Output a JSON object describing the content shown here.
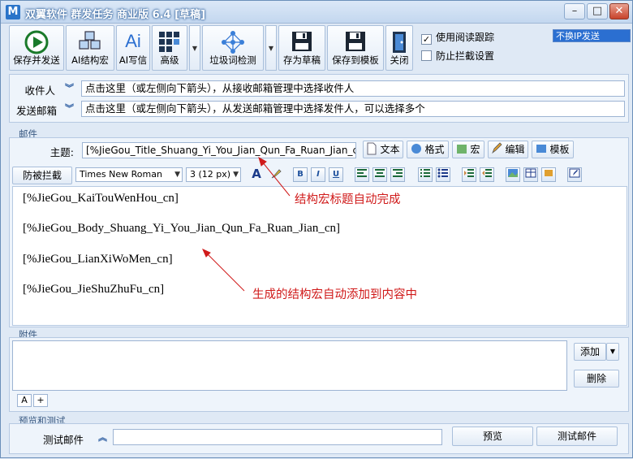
{
  "window": {
    "title": "双翼软件 群发任务 商业版 6.4 [草稿]",
    "app_icon_letter": "M",
    "min_glyph": "–",
    "max_glyph": "□",
    "close_glyph": "✕"
  },
  "toolbar": {
    "save_send": "保存并发送",
    "ai_macro": "AI结构宏",
    "ai_write": "AI写信",
    "advanced": "高级",
    "spam_check": "垃圾词检测",
    "save_draft": "存为草稿",
    "save_template": "保存到模板",
    "close": "关闭",
    "ai_icon_text": "Ai"
  },
  "options": {
    "read_tracking_label": "使用阅读跟踪",
    "read_tracking_checked": true,
    "anti_block_label": "防止拦截设置",
    "anti_block_checked": false,
    "ip_mode": "不换IP发送"
  },
  "recipients": {
    "to_label": "收件人",
    "to_value": "点击这里（或左侧向下箭头），从接收邮箱管理中选择收件人",
    "from_label": "发送邮箱",
    "from_value": "点击这里（或左侧向下箭头），从发送邮箱管理中选择发件人，可以选择多个"
  },
  "mail": {
    "group_label": "邮件",
    "subject_label": "主题:",
    "subject_value": "[%JieGou_Title_Shuang_Yi_You_Jian_Qun_Fa_Ruan_Jian_cn]",
    "btn_text": "文本",
    "btn_format": "格式",
    "btn_macro": "宏",
    "btn_edit": "编辑",
    "btn_template": "模板"
  },
  "format_bar": {
    "anti_block": "防被拦截",
    "font": "Times New Roman",
    "size": "3 (12 px)",
    "bold": "B",
    "italic": "I",
    "underline": "U",
    "font_color_glyph": "A"
  },
  "body": {
    "lines": [
      "[%JieGou_KaiTouWenHou_cn]",
      "[%JieGou_Body_Shuang_Yi_You_Jian_Qun_Fa_Ruan_Jian_cn]",
      "[%JieGou_LianXiWoMen_cn]",
      "[%JieGou_JieShuZhuFu_cn]"
    ],
    "annotation_title": "结构宏标题自动完成",
    "annotation_body": "生成的结构宏自动添加到内容中"
  },
  "attachments": {
    "group_label": "附件",
    "add": "添加",
    "delete": "删除",
    "tab_a": "A",
    "tab_plus": "+"
  },
  "preview": {
    "group_label": "预览和测试",
    "test_mail_label": "测试邮件",
    "test_mail_value": "",
    "preview_btn": "预览",
    "test_btn": "测试邮件"
  },
  "colors": {
    "accent_blue": "#2b6fd1",
    "annotation_red": "#d01a1a",
    "panel_bg": "#eef4fb"
  }
}
